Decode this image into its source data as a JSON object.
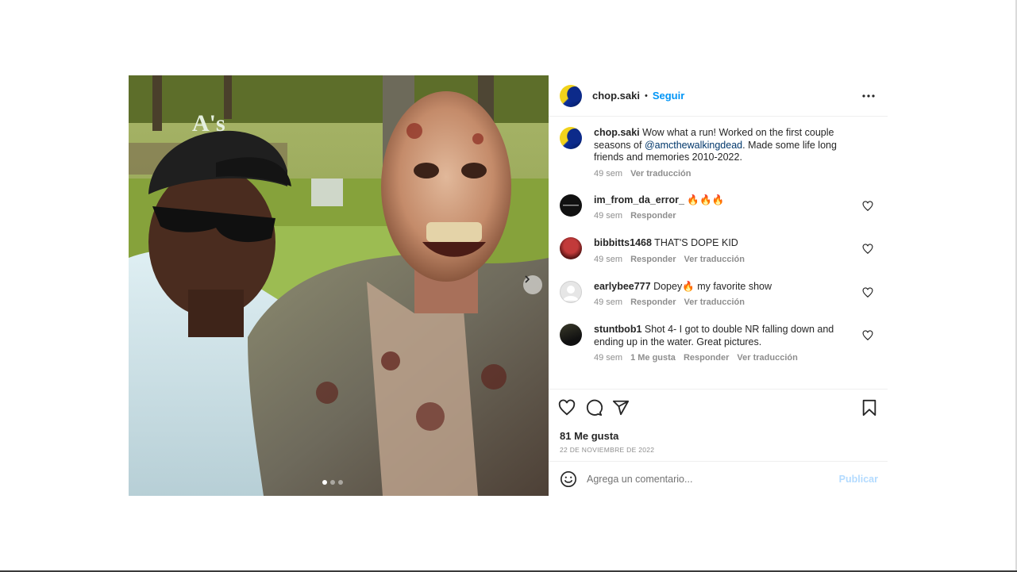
{
  "post": {
    "author": {
      "username": "chop.saki",
      "separator": "•",
      "follow_label": "Seguir"
    },
    "media": {
      "alt": "photo",
      "slide_count": 3,
      "active_slide": 1
    },
    "caption": {
      "username": "chop.saki",
      "text_before": " Wow what a run! Worked on the first couple seasons of ",
      "mention": "@amcthewalkingdead",
      "text_after": ". Made some life long friends and memories 2010-2022.",
      "time": "49 sem",
      "translate_label": "Ver traducción"
    },
    "comments": [
      {
        "username": "im_from_da_error_",
        "text": " 🔥🔥🔥",
        "time": "49 sem",
        "reply_label": "Responder",
        "likes_label": "",
        "translate_label": ""
      },
      {
        "username": "bibbitts1468",
        "text": " THAT'S DOPE KID",
        "time": "49 sem",
        "reply_label": "Responder",
        "likes_label": "",
        "translate_label": "Ver traducción"
      },
      {
        "username": "earlybee777",
        "text": " Dopey🔥 my favorite show",
        "time": "49 sem",
        "reply_label": "Responder",
        "likes_label": "",
        "translate_label": "Ver traducción"
      },
      {
        "username": "stuntbob1",
        "text": " Shot 4- I got to double NR falling down and ending up in the water. Great pictures.",
        "time": "49 sem",
        "reply_label": "Responder",
        "likes_label": "1 Me gusta",
        "translate_label": "Ver traducción"
      }
    ],
    "likes_label": "81 Me gusta",
    "date_label": "22 DE NOVIEMBRE DE 2022",
    "comment_box": {
      "placeholder": "Agrega un comentario...",
      "publish_label": "Publicar"
    },
    "icons": {
      "more": "more-options-icon",
      "like": "heart-icon",
      "comment": "comment-bubble-icon",
      "share": "paper-plane-icon",
      "save": "bookmark-icon",
      "emoji": "emoji-smile-icon",
      "next": "chevron-right-icon"
    },
    "colors": {
      "link_blue": "#0095f6",
      "mention_blue": "#00376b",
      "publish_disabled": "#b3dbff",
      "meta_grey": "#8e8e8e"
    }
  }
}
